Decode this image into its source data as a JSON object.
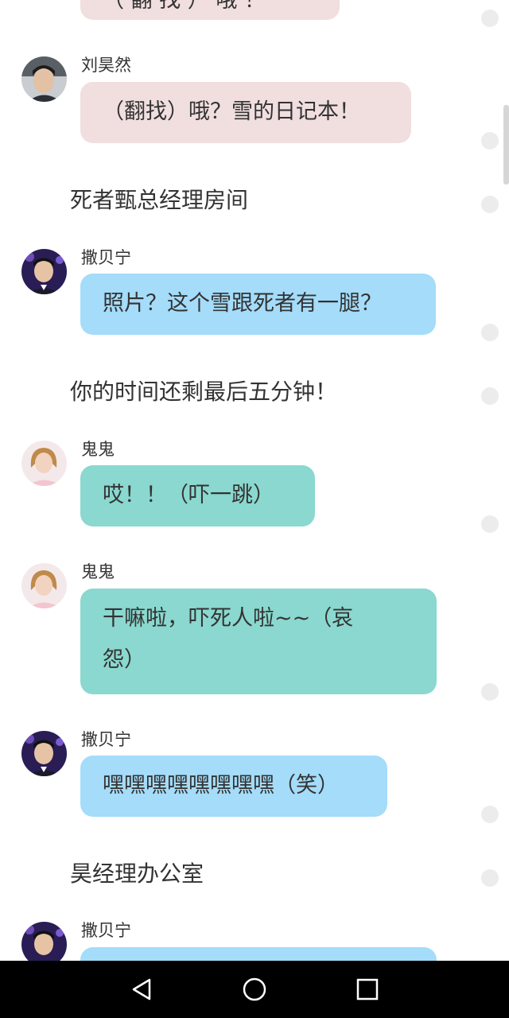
{
  "messages": {
    "top_partial": "（ 翻 找 ）  哦 ！",
    "m1": {
      "name": "刘昊然",
      "text": "（翻找）哦？雪的日记本！"
    },
    "scene1": "死者甄总经理房间",
    "m2": {
      "name": "撒贝宁",
      "text": "照片？这个雪跟死者有一腿？"
    },
    "scene2": "你的时间还剩最后五分钟！",
    "m3": {
      "name": "鬼鬼",
      "text": "哎！！（吓一跳）"
    },
    "m4": {
      "name": "鬼鬼",
      "text_line1": "干嘛啦，吓死人啦~~（哀",
      "text_line2": "怨）"
    },
    "m5": {
      "name": "撒贝宁",
      "text": "嘿嘿嘿嘿嘿嘿嘿嘿（笑）"
    },
    "scene3": "昊经理办公室",
    "m6": {
      "name": "撒贝宁"
    }
  },
  "colors": {
    "pink_bubble": "#f1dedf",
    "blue_bubble": "#a4dcfa",
    "teal_bubble": "#8ad8cf",
    "navbar": "#000000"
  },
  "navbar": {
    "back_icon": "back-triangle-icon",
    "home_icon": "home-circle-icon",
    "recents_icon": "recents-square-icon"
  }
}
